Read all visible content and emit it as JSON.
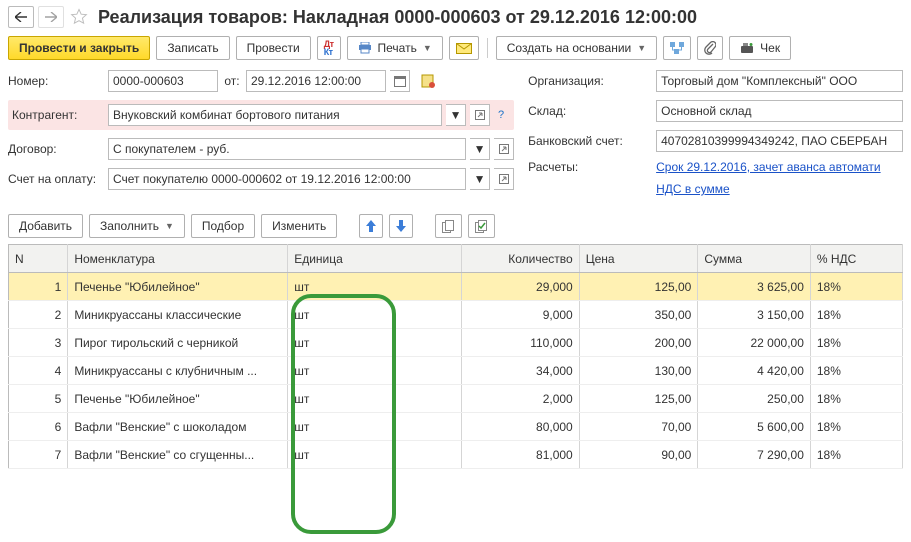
{
  "title": "Реализация товаров: Накладная 0000-000603 от 29.12.2016 12:00:00",
  "toolbar": {
    "post_close": "Провести и закрыть",
    "write": "Записать",
    "post": "Провести",
    "print": "Печать",
    "create_based": "Создать на основании",
    "check": "Чек"
  },
  "fields": {
    "number_lbl": "Номер:",
    "number": "0000-000603",
    "from_lbl": "от:",
    "date": "29.12.2016 12:00:00",
    "contractor_lbl": "Контрагент:",
    "contractor": "Внуковский комбинат бортового питания",
    "contract_lbl": "Договор:",
    "contract": "С покупателем - руб.",
    "invoice_lbl": "Счет на оплату:",
    "invoice": "Счет покупателю 0000-000602 от 19.12.2016 12:00:00",
    "org_lbl": "Организация:",
    "org": "Торговый дом \"Комплексный\" ООО",
    "warehouse_lbl": "Склад:",
    "warehouse": "Основной склад",
    "bank_lbl": "Банковский счет:",
    "bank": "40702810399994349242, ПАО СБЕРБАН",
    "settlements_lbl": "Расчеты:",
    "settlements": "Срок 29.12.2016, зачет аванса автомати",
    "vat_in_sum": "НДС в сумме"
  },
  "grid_toolbar": {
    "add": "Добавить",
    "fill": "Заполнить",
    "select": "Подбор",
    "change": "Изменить"
  },
  "columns": {
    "n": "N",
    "nomenclature": "Номенклатура",
    "unit": "Единица",
    "qty": "Количество",
    "price": "Цена",
    "sum": "Сумма",
    "vat": "% НДС"
  },
  "rows": [
    {
      "n": "1",
      "name": "Печенье \"Юбилейное\"",
      "unit": "шт",
      "qty": "29,000",
      "price": "125,00",
      "sum": "3 625,00",
      "vat": "18%",
      "selected": true
    },
    {
      "n": "2",
      "name": "Миникруассаны классические",
      "unit": "шт",
      "qty": "9,000",
      "price": "350,00",
      "sum": "3 150,00",
      "vat": "18%"
    },
    {
      "n": "3",
      "name": "Пирог тирольский с черникой",
      "unit": "шт",
      "qty": "110,000",
      "price": "200,00",
      "sum": "22 000,00",
      "vat": "18%"
    },
    {
      "n": "4",
      "name": "Миникруассаны с клубничным ...",
      "unit": "шт",
      "qty": "34,000",
      "price": "130,00",
      "sum": "4 420,00",
      "vat": "18%"
    },
    {
      "n": "5",
      "name": "Печенье \"Юбилейное\"",
      "unit": "шт",
      "qty": "2,000",
      "price": "125,00",
      "sum": "250,00",
      "vat": "18%"
    },
    {
      "n": "6",
      "name": "Вафли \"Венские\" с шоколадом",
      "unit": "шт",
      "qty": "80,000",
      "price": "70,00",
      "sum": "5 600,00",
      "vat": "18%"
    },
    {
      "n": "7",
      "name": "Вафли \"Венские\" со сгущенны...",
      "unit": "шт",
      "qty": "81,000",
      "price": "90,00",
      "sum": "7 290,00",
      "vat": "18%"
    }
  ]
}
